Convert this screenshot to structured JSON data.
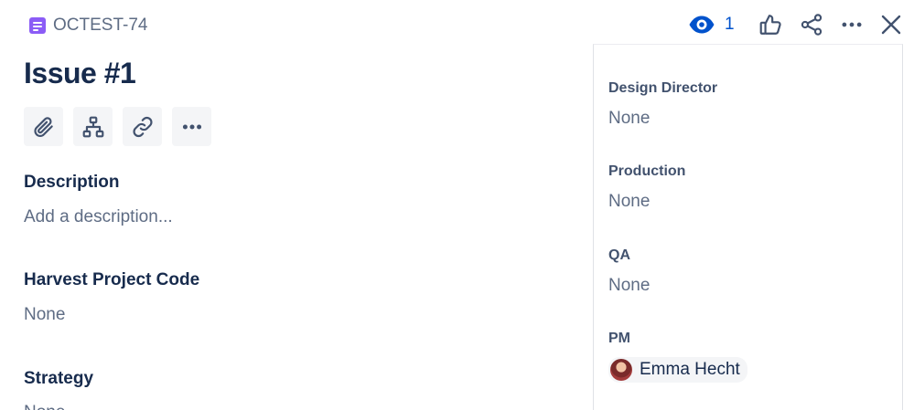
{
  "issue": {
    "key": "OCTEST-74",
    "title": "Issue #1"
  },
  "header": {
    "watch_count": "1"
  },
  "fields_left": [
    {
      "label": "Description",
      "value": "Add a description..."
    },
    {
      "label": "Harvest Project Code",
      "value": "None"
    },
    {
      "label": "Strategy",
      "value": "None"
    }
  ],
  "fields_right": [
    {
      "label": "Design Director",
      "value": "None"
    },
    {
      "label": "Production",
      "value": "None"
    },
    {
      "label": "QA",
      "value": "None"
    },
    {
      "label": "PM",
      "value": "Emma Hecht"
    }
  ],
  "icons": {
    "issue_type": "page-icon",
    "toolbar": [
      "paperclip-icon",
      "child-issues-icon",
      "link-icon",
      "more-icon"
    ],
    "header": [
      "eye-icon",
      "thumbs-up-icon",
      "share-icon",
      "more-icon",
      "close-icon"
    ]
  },
  "colors": {
    "issue_type": "#8B5CF6",
    "watch": "#0052CC",
    "text": "#172B4D",
    "muted": "#5E6C84"
  }
}
